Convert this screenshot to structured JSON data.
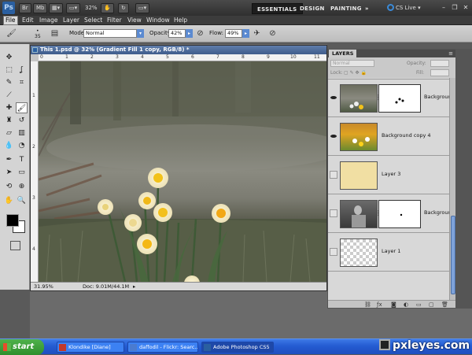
{
  "app": {
    "logo": "Ps",
    "zoom": "32%",
    "workspaces": [
      "ESSENTIALS",
      "DESIGN",
      "PAINTING"
    ],
    "more": "»",
    "cs_live": "CS Live ▾"
  },
  "menu": [
    "File",
    "Edit",
    "Image",
    "Layer",
    "Select",
    "Filter",
    "View",
    "Window",
    "Help"
  ],
  "options": {
    "brush_size": "35",
    "mode_label": "Mode:",
    "mode_value": "Normal",
    "opacity_label": "Opacity:",
    "opacity_value": "42%",
    "flow_label": "Flow:",
    "flow_value": "49%"
  },
  "document": {
    "title": "This 1.psd @ 32% (Gradient Fill 1 copy, RGB/8) *",
    "zoom": "31.95%",
    "doc_info": "Doc: 9.01M/44.1M",
    "ruler_top": [
      "0",
      "1",
      "2",
      "3",
      "4",
      "5",
      "6",
      "7",
      "8",
      "9",
      "10",
      "11"
    ],
    "ruler_left": [
      "1",
      "2",
      "3",
      "4"
    ]
  },
  "layers": {
    "tab": "LAYERS",
    "blend_mode": "Normal",
    "opacity_label": "Opacity:",
    "lock_label": "Lock:",
    "fill_label": "Fill:",
    "items": [
      {
        "name": "Background"
      },
      {
        "name": "Background copy 4"
      },
      {
        "name": "Layer 3"
      },
      {
        "name": "Background..."
      },
      {
        "name": "Layer 1"
      }
    ]
  },
  "taskbar": {
    "start": "start",
    "tasks": [
      "Klondike [Diane]",
      "daffodil - Flickr: Searc...",
      "Adobe Photoshop CS5"
    ]
  },
  "watermark": "pxleyes.com",
  "colors": {
    "title_blue": "#4a67a0",
    "taskbar_blue": "#245bd2",
    "start_green": "#3a9a36",
    "daffodil_yellow": "#f2c21a"
  }
}
